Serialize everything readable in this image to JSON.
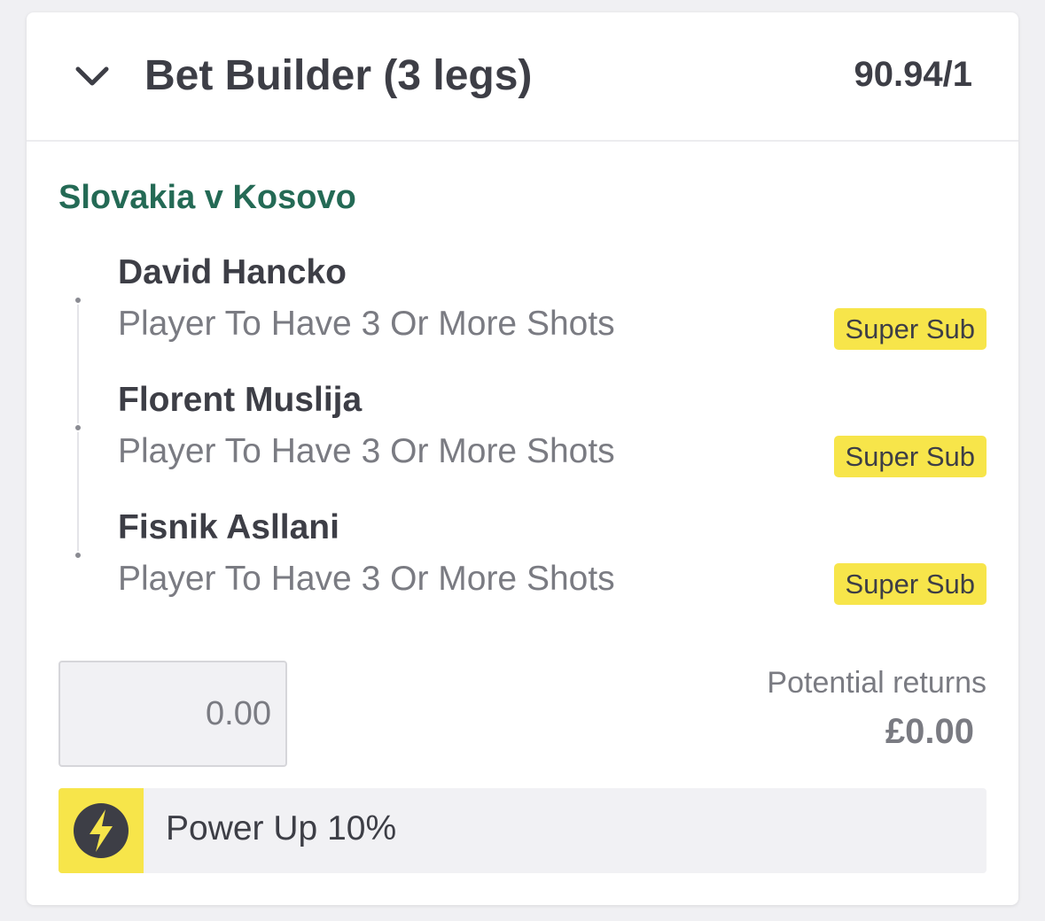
{
  "bet": {
    "title": "Bet Builder (3 legs)",
    "odds": "90.94/1",
    "event": "Slovakia v Kosovo",
    "legs": [
      {
        "player": "David Hancko",
        "market": "Player To Have 3 Or More Shots",
        "badge": "Super Sub"
      },
      {
        "player": "Florent Muslija",
        "market": "Player To Have 3 Or More Shots",
        "badge": "Super Sub"
      },
      {
        "player": "Fisnik Asllani",
        "market": "Player To Have 3 Or More Shots",
        "badge": "Super Sub"
      }
    ],
    "stake_placeholder": "0.00",
    "returns_label": "Potential returns",
    "returns_value": "£0.00",
    "powerup_label": "Power Up 10%"
  },
  "icons": {
    "collapse": "chevron-down-icon",
    "powerup": "lightning-bolt-icon"
  },
  "colors": {
    "accent_yellow": "#f7e54a",
    "event_green": "#246a55",
    "text_dark": "#3d3e46",
    "text_muted": "#7a7b82"
  }
}
